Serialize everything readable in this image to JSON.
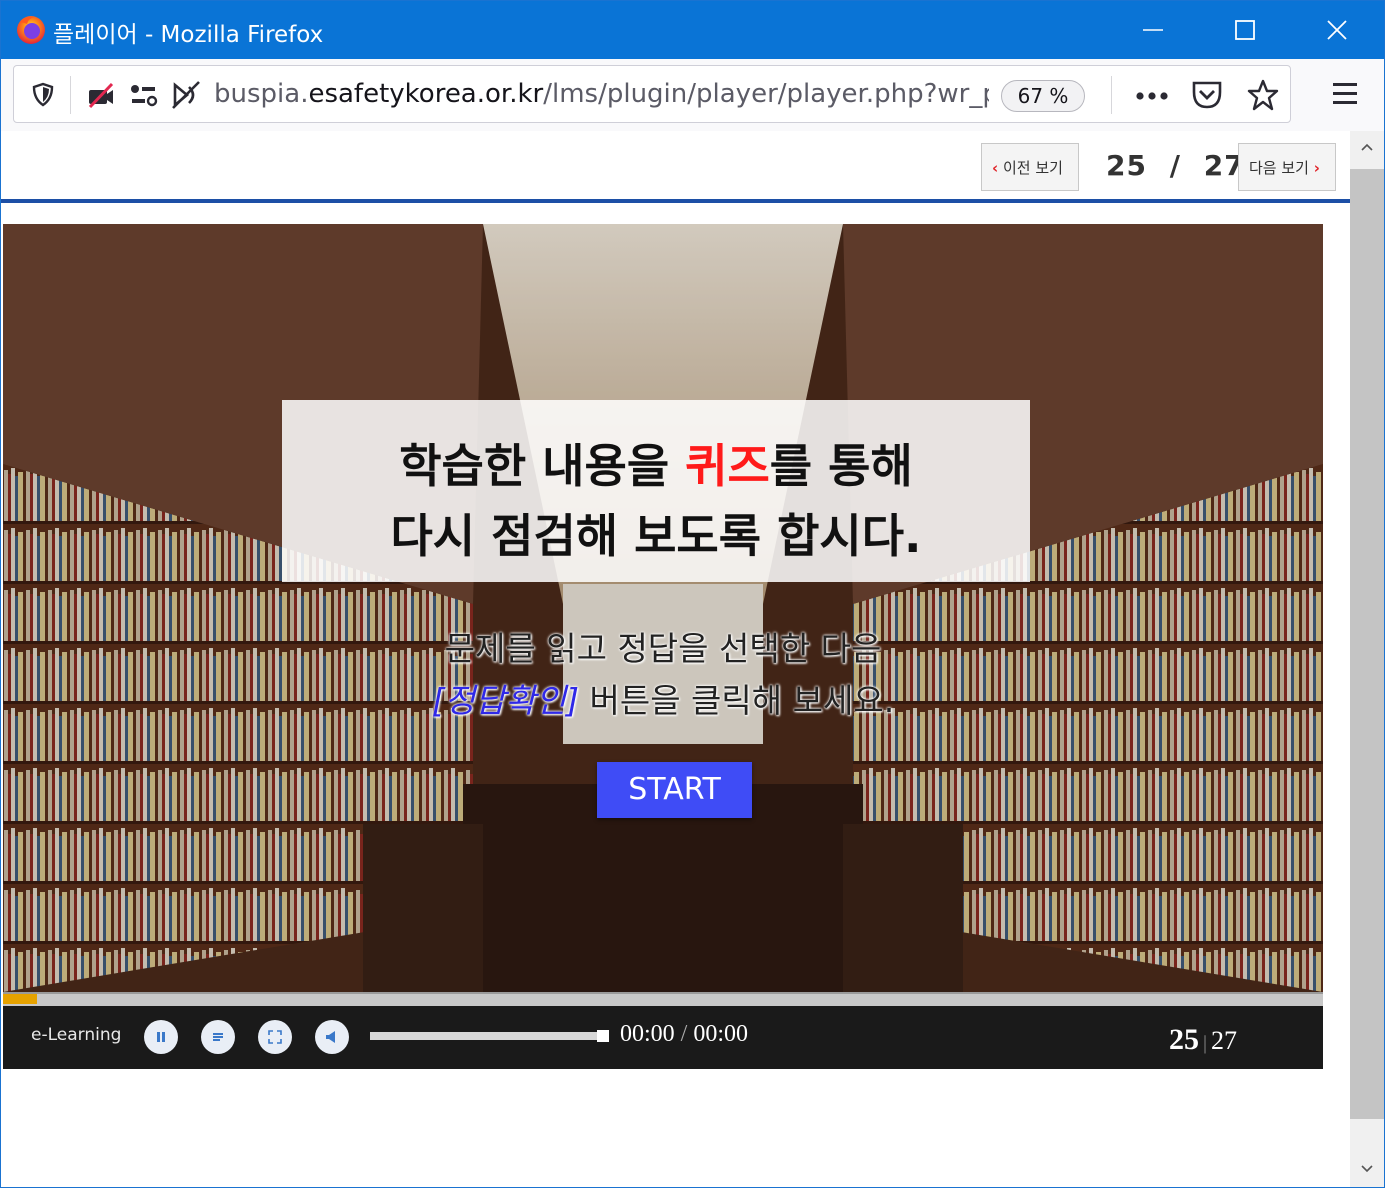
{
  "window": {
    "title": "플레이어 - Mozilla Firefox"
  },
  "navbar": {
    "url_prefix": "buspia.",
    "url_domain": "esafetykorea.or.kr",
    "url_path": "/lms/plugin/player/player.php?wr_pag",
    "zoom": "67 %",
    "icons": [
      "shield-icon",
      "camera-blocked-icon",
      "permissions-icon",
      "autoplay-blocked-icon",
      "more-icon",
      "pocket-icon",
      "bookmark-star-icon",
      "hamburger-menu-icon"
    ]
  },
  "page_nav": {
    "prev_label": "이전 보기",
    "next_label": "다음 보기",
    "current": "25",
    "separator": "/",
    "total": "27"
  },
  "slide": {
    "line1_pre": "학습한 내용을 ",
    "line1_red": "퀴즈",
    "line1_post": "를 통해",
    "line2": "다시 점검해 보도록 합시다.",
    "instr1": "문제를 읽고 정답을 선택한 다음",
    "instr2_blue": "[정답확인]",
    "instr2_post": " 버튼을 클릭해 보세요.",
    "start_label": "START"
  },
  "player": {
    "label": "e-Learning",
    "time_current": "00:00",
    "time_sep": "/",
    "time_total": "00:00",
    "page_current": "25",
    "page_sep": "|",
    "page_total": "27",
    "progress_fraction": 0.026,
    "controls": [
      "pause-icon",
      "list-icon",
      "fullscreen-icon",
      "volume-icon"
    ]
  },
  "colors": {
    "titlebar": "#0a74d6",
    "accent_line": "#1c4fa6",
    "start_button": "#3f4cf6",
    "quiz_red": "#ff1a1a",
    "instr_blue": "#2f28e8"
  }
}
